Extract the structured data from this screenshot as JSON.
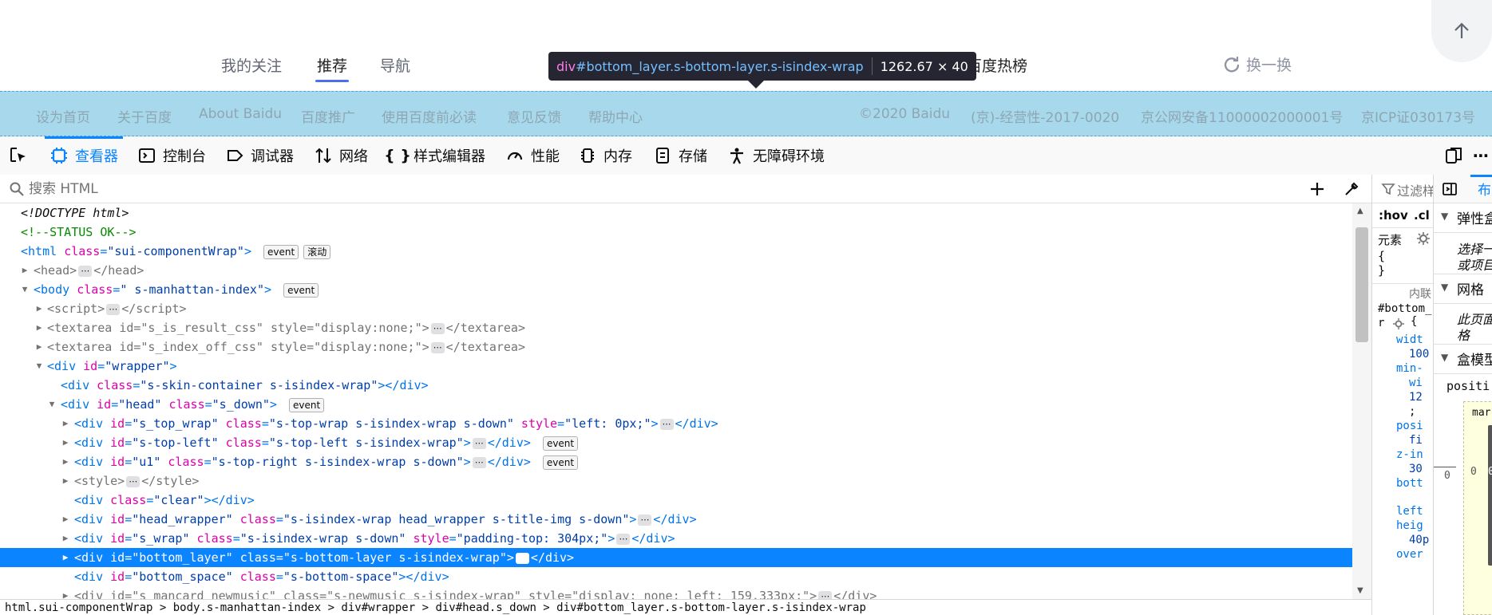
{
  "page": {
    "tabs": [
      {
        "label": "我的关注",
        "active": false
      },
      {
        "label": "推荐",
        "active": true
      },
      {
        "label": "导航",
        "active": false
      }
    ],
    "hot_title": "百度热榜",
    "refresh_label": "换一换",
    "tooltip": {
      "tag": "div",
      "selector": "#bottom_layer.s-bottom-layer.s-isindex-wrap",
      "dimensions": "1262.67 × 40"
    },
    "bottom_links": [
      "设为首页",
      "关于百度",
      "About Baidu",
      "百度推广",
      "使用百度前必读",
      "意见反馈",
      "帮助中心"
    ],
    "bottom_right": [
      "©2020 Baidu",
      "(京)-经营性-2017-0020",
      "京公网安备11000002000001号",
      "京ICP证030173号"
    ]
  },
  "devtools": {
    "tabs": [
      {
        "label": "查看器",
        "icon": "inspector-icon",
        "active": true
      },
      {
        "label": "控制台",
        "icon": "console-icon"
      },
      {
        "label": "调试器",
        "icon": "debugger-icon"
      },
      {
        "label": "网络",
        "icon": "network-icon"
      },
      {
        "label": "样式编辑器",
        "icon": "style-editor-icon"
      },
      {
        "label": "性能",
        "icon": "performance-icon"
      },
      {
        "label": "内存",
        "icon": "memory-icon"
      },
      {
        "label": "存储",
        "icon": "storage-icon"
      },
      {
        "label": "无障碍环境",
        "icon": "accessibility-icon"
      }
    ],
    "search_placeholder": "搜索 HTML",
    "badges": {
      "event": "event",
      "scroll": "滚动",
      "dots": "⋯"
    },
    "tree": {
      "doctype": "<!DOCTYPE html>",
      "comment": "<!--STATUS OK-->",
      "html_class": "\"sui-componentWrap\"",
      "body_class": "\" s-manhattan-index\"",
      "script": "script",
      "textarea1_id": "\"s_is_result_css\"",
      "textarea2_id": "\"s_index_off_css\"",
      "textarea_style": "\"display:none;\"",
      "wrapper_id": "\"wrapper\"",
      "skin_class": "\"s-skin-container s-isindex-wrap\"",
      "head_id": "\"head\"",
      "head_class": "\"s_down\"",
      "s_top_wrap_id": "\"s_top_wrap\"",
      "s_top_wrap_class": "\"s-top-wrap s-isindex-wrap s-down\"",
      "s_top_wrap_style": "\"left: 0px;\"",
      "s_top_left_id": "\"s-top-left\"",
      "s_top_left_class": "\"s-top-left s-isindex-wrap\"",
      "u1_id": "\"u1\"",
      "u1_class": "\"s-top-right s-isindex-wrap s-down\"",
      "clear_class": "\"clear\"",
      "head_wrapper_id": "\"head_wrapper\"",
      "head_wrapper_class": "\"s-isindex-wrap head_wrapper s-title-img s-down\"",
      "s_wrap_id": "\"s_wrap\"",
      "s_wrap_class": "\"s-isindex-wrap s-down\"",
      "s_wrap_style": "\"padding-top: 304px;\"",
      "bottom_layer_id": "\"bottom_layer\"",
      "bottom_layer_class": "\"s-bottom-layer s-isindex-wrap\"",
      "bottom_space_id": "\"bottom_space\"",
      "bottom_space_class": "\"s-bottom-space\"",
      "newmusic_id": "\"s_mancard_newmusic\"",
      "newmusic_class": "\"s-newmusic s-isindex-wrap\"",
      "newmusic_style": "\"display: none; left: 159.333px;\""
    },
    "breadcrumbs": "html.sui-componentWrap > body.s-manhattan-index > div#wrapper > div#head.s_down > div#bottom_layer.s-bottom-layer.s-isindex-wrap",
    "rules": {
      "filter_placeholder": "过滤样",
      "hov": ":hov",
      "cls": ".cl",
      "element_label": "元素",
      "brace_open": "{",
      "brace_close": "}",
      "inline_label": "内联",
      "selector_a": "#bottom_",
      "selector_b": "r",
      "lines": [
        "widt",
        "100",
        "min-",
        "wi",
        "12",
        ";",
        "posi",
        "fi",
        "z-in",
        "30",
        "bott",
        "left",
        "heig",
        "40p",
        "over"
      ]
    },
    "layout": {
      "tab_label": "布",
      "sections": [
        "弹性盒",
        "网格",
        "盒模型"
      ],
      "flex_hint_a": "选择一",
      "flex_hint_b": "或项目",
      "grid_hint_a": "此页面",
      "grid_hint_b": "格",
      "position_label": "positi",
      "margin_label": "mar",
      "margin_left": "0",
      "margin_val": "0",
      "inner_val": "0"
    }
  }
}
